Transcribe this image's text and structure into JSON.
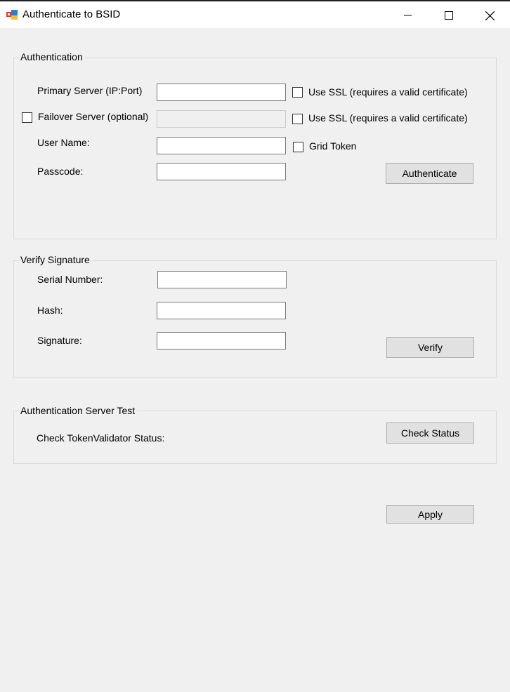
{
  "window": {
    "title": "Authenticate to BSID",
    "icon": "app-icon",
    "controls": [
      "minimize-icon",
      "maximize-icon",
      "close-icon"
    ]
  },
  "authentication": {
    "legend": "Authentication",
    "primary_server_label": "Primary Server (IP:Port)",
    "primary_server_value": "",
    "primary_ssl_label": "Use SSL (requires a valid certificate)",
    "primary_ssl_checked": false,
    "failover_label": "Failover Server (optional)",
    "failover_checked": false,
    "failover_value": "",
    "failover_ssl_label": "Use SSL (requires a valid certificate)",
    "failover_ssl_checked": false,
    "username_label": "User Name:",
    "username_value": "",
    "grid_token_label": "Grid Token",
    "grid_token_checked": false,
    "passcode_label": "Passcode:",
    "passcode_value": "",
    "authenticate_button": "Authenticate"
  },
  "verify": {
    "legend": "Verify Signature",
    "serial_label": "Serial Number:",
    "serial_value": "",
    "hash_label": "Hash:",
    "hash_value": "",
    "signature_label": "Signature:",
    "signature_value": "",
    "verify_button": "Verify"
  },
  "server_test": {
    "legend": "Authentication Server Test",
    "status_label": "Check TokenValidator Status:",
    "check_button": "Check Status"
  },
  "apply_button": "Apply"
}
